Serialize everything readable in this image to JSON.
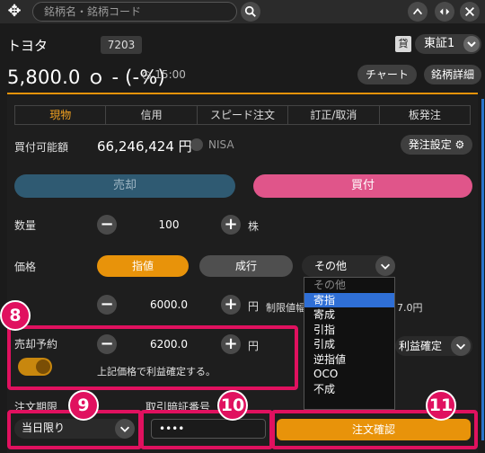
{
  "topbar": {
    "search_placeholder": "銘柄名・銘柄コード"
  },
  "stock": {
    "name": "トヨタ",
    "code": "7203",
    "lend_badge": "貸",
    "market": "東証1",
    "price": "5,800.0 ｏ - (-%)",
    "time": "15:00",
    "chart_button": "チャート",
    "detail_button": "銘柄詳細"
  },
  "tabs": [
    {
      "label": "現物",
      "active": true
    },
    {
      "label": "信用"
    },
    {
      "label": "スピード注文"
    },
    {
      "label": "訂正/取消"
    },
    {
      "label": "板発注"
    }
  ],
  "account": {
    "buying_power_label": "買付可能額",
    "buying_power": "66,246,424 円",
    "nisa_label": "NISA",
    "settings_button": "発注設定"
  },
  "side": {
    "sell_label": "売却",
    "buy_label": "買付"
  },
  "quantity": {
    "label": "数量",
    "value": "100",
    "unit": "株"
  },
  "price_type": {
    "label": "価格",
    "limit": "指値",
    "market": "成行",
    "other": "その他"
  },
  "price_input": {
    "value": "6000.0",
    "unit": "円",
    "limit_label": "制限値幅",
    "limit_value": "7.0円"
  },
  "dropdown": {
    "items": [
      "その他",
      "寄指",
      "寄成",
      "引指",
      "引成",
      "逆指値",
      "OCO",
      "不成"
    ],
    "selected_index": 1
  },
  "profit_order": {
    "label": "売却予約",
    "value": "6200.0",
    "unit": "円",
    "note": "上記価格で利益確定する。",
    "select_label": "利益確定",
    "toggle_on": true
  },
  "term": {
    "label": "注文期限",
    "value": "当日限り"
  },
  "pin": {
    "label": "取引暗証番号",
    "value": "••••"
  },
  "confirm_button": "注文確認",
  "annotations": {
    "n8": "8",
    "n9": "9",
    "n10": "10",
    "n11": "11"
  },
  "colors": {
    "accent_orange": "#e8930a",
    "annotation_red": "#e0115f",
    "buy_pink": "#e0558a",
    "sell_blue": "#2f5a72",
    "selected_blue": "#2f6fd6"
  }
}
